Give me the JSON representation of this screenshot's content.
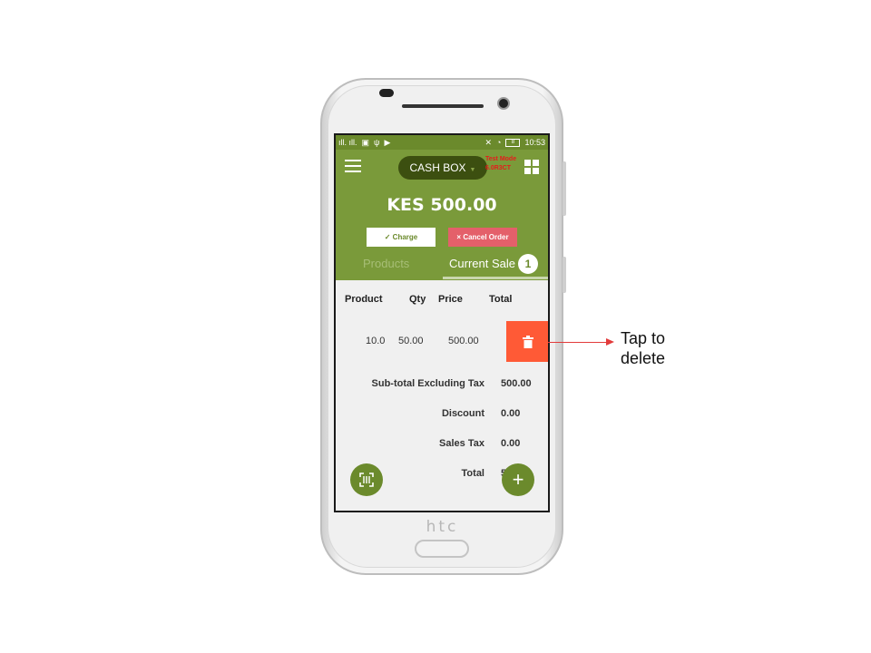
{
  "status_bar": {
    "signal": "ıll. ıll.",
    "time": "10:53",
    "battery": "8"
  },
  "app_bar": {
    "cashbox_label": "CASH BOX",
    "test_mode_line1": "Test Mode",
    "test_mode_line2": "6.0R3CT"
  },
  "summary": {
    "amount": "KES 500.00",
    "charge_label": "✓ Charge",
    "cancel_label": "× Cancel Order"
  },
  "tabs": {
    "products": "Products",
    "current_sale": "Current Sale",
    "current_sale_count": "1"
  },
  "table": {
    "headers": [
      "Product",
      "Qty",
      "Price",
      "Total"
    ],
    "rows": [
      {
        "qty_leading": "10.0",
        "qty": "50.00",
        "price": "500.00"
      }
    ]
  },
  "totals": {
    "subtotal_label": "Sub-total Excluding Tax",
    "subtotal_value": "500.00",
    "discount_label": "Discount",
    "discount_value": "0.00",
    "tax_label": "Sales Tax",
    "tax_value": "0.00",
    "total_label": "Total",
    "total_value": "5   0"
  },
  "annotation": {
    "line1": "Tap to",
    "line2": "delete"
  },
  "device": {
    "brand": "htc"
  },
  "colors": {
    "primary_green": "#7a9a3a",
    "delete_red": "#ff5a36",
    "cancel_red": "#e4606a"
  }
}
